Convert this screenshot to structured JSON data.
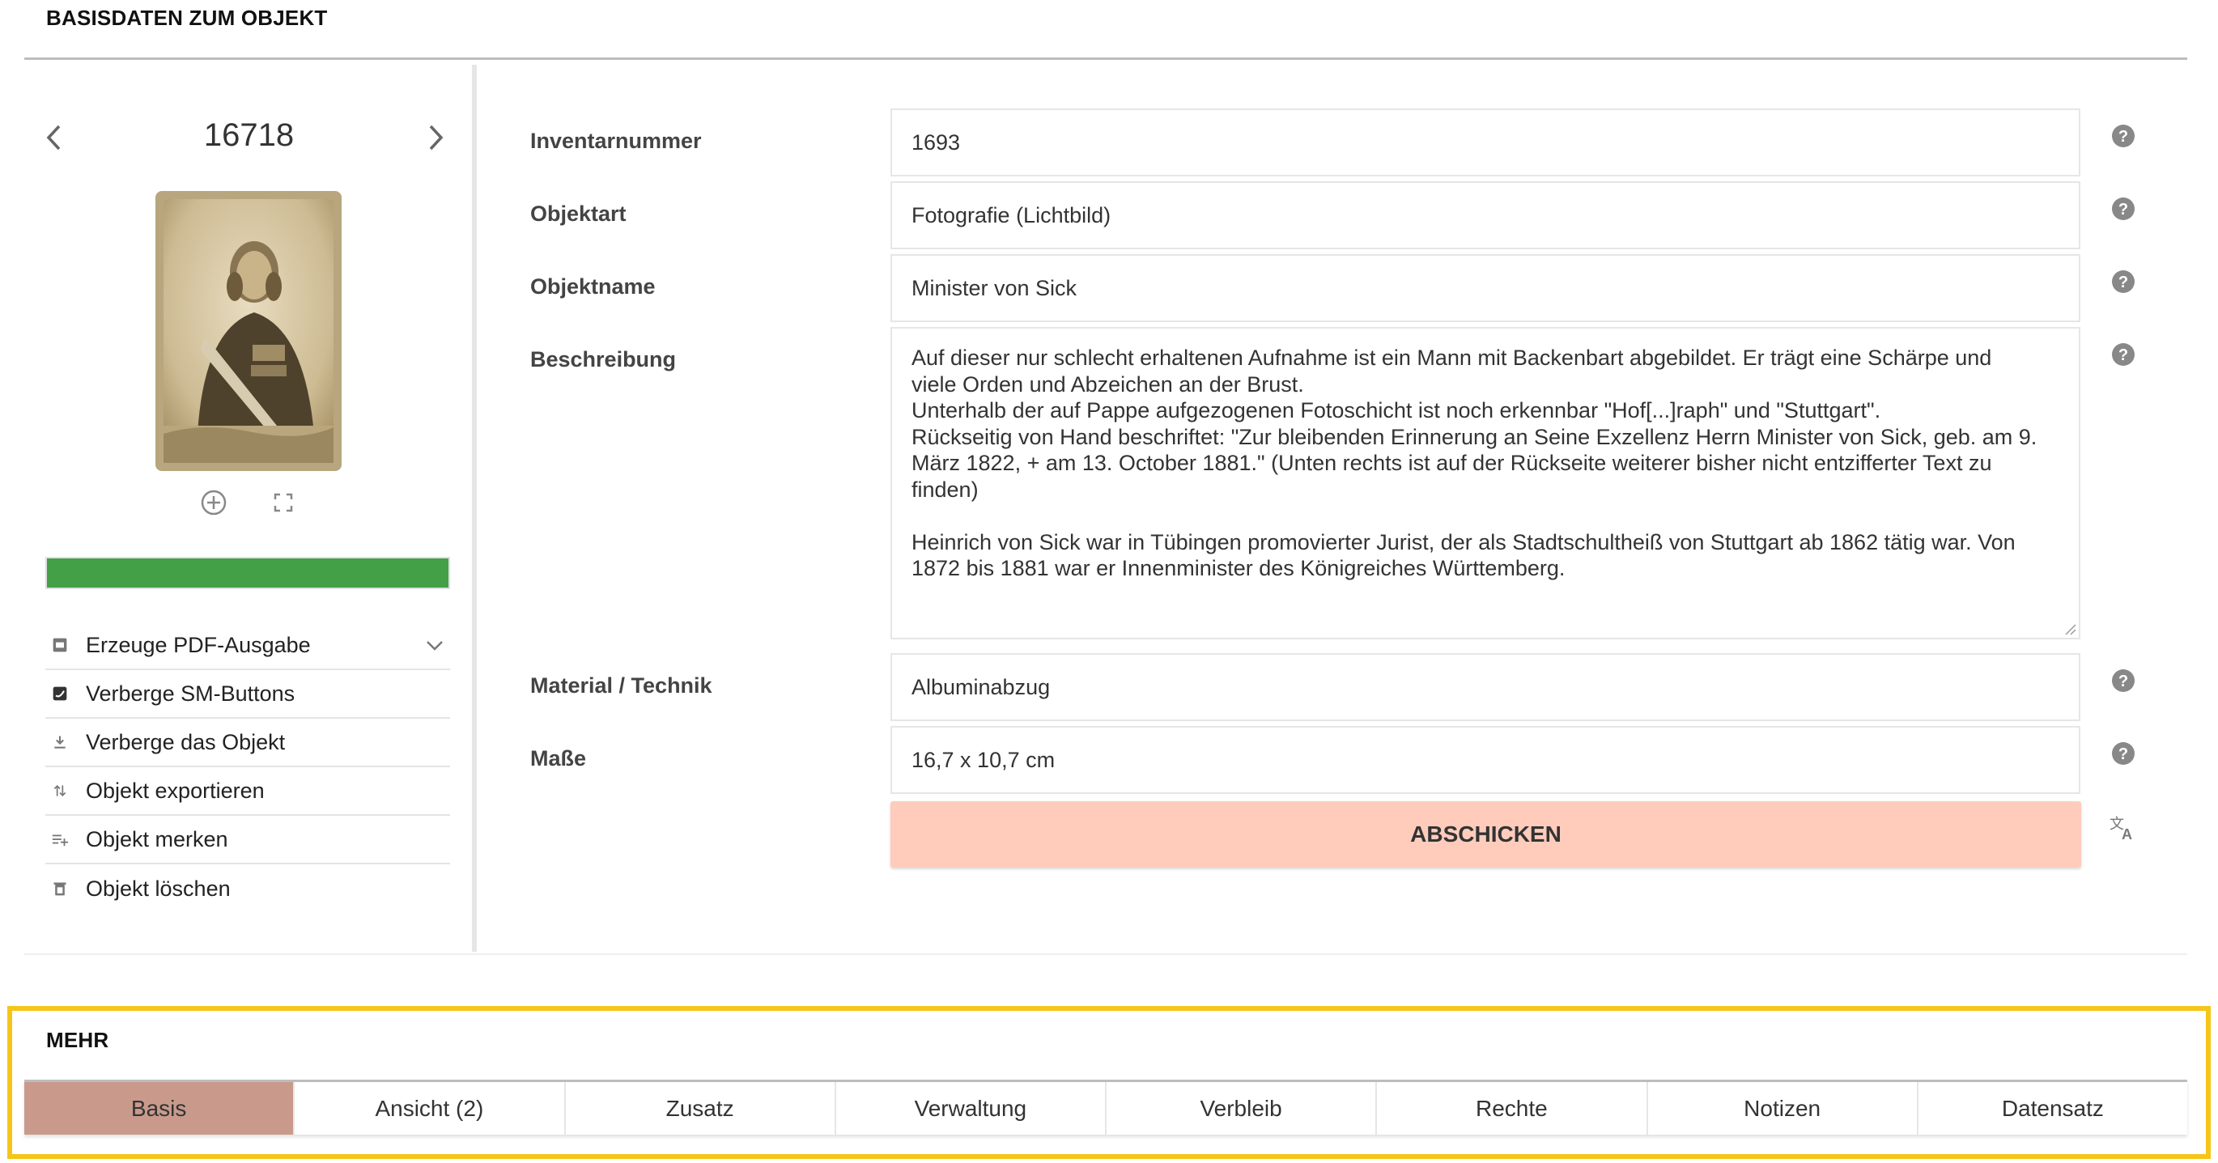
{
  "header": {
    "title": "BASISDATEN ZUM OBJEKT"
  },
  "viewer": {
    "object_number": "16718",
    "progress_fraction": 1.0
  },
  "actions": [
    {
      "label": "Erzeuge PDF-Ausgabe",
      "icon": "pdf-icon"
    },
    {
      "label": "Verberge SM-Buttons",
      "icon": "social-media-icon"
    },
    {
      "label": "Verberge das Objekt",
      "icon": "download-icon"
    },
    {
      "label": "Objekt exportieren",
      "icon": "export-arrows-icon"
    },
    {
      "label": "Objekt merken",
      "icon": "playlist-add-icon"
    },
    {
      "label": "Objekt löschen",
      "icon": "trash-icon"
    }
  ],
  "form": {
    "inventarnummer": {
      "label": "Inventarnummer",
      "value": "1693"
    },
    "objektart": {
      "label": "Objektart",
      "value": "Fotografie (Lichtbild)"
    },
    "objektname": {
      "label": "Objektname",
      "value": "Minister von Sick"
    },
    "beschreibung": {
      "label": "Beschreibung",
      "value": "Auf dieser nur schlecht erhaltenen Aufnahme ist ein Mann mit Backenbart abgebildet. Er trägt eine Schärpe und\nviele Orden und Abzeichen an der Brust.\nUnterhalb der auf Pappe aufgezogenen Fotoschicht ist noch erkennbar \"Hof[...]raph\" und \"Stuttgart\".\nRückseitig von Hand beschriftet: \"Zur bleibenden Erinnerung an Seine Exzellenz Herrn Minister von Sick, geb. am 9.\nMärz 1822, + am 13. October 1881.\" (Unten rechts ist auf der Rückseite weiterer bisher nicht entzifferter Text zu\nfinden)\n\nHeinrich von Sick war in Tübingen promovierter Jurist, der als Stadtschultheiß von Stuttgart ab 1862 tätig war. Von\n1872 bis 1881 war er Innenminister des Königreiches Württemberg."
    },
    "material": {
      "label": "Material / Technik",
      "value": "Albuminabzug"
    },
    "masse": {
      "label": "Maße",
      "value": "16,7 x 10,7 cm"
    },
    "submit_label": "ABSCHICKEN"
  },
  "mehr": {
    "title": "MEHR",
    "tabs": [
      "Basis",
      "Ansicht (2)",
      "Zusatz",
      "Verwaltung",
      "Verbleib",
      "Rechte",
      "Notizen",
      "Datensatz"
    ],
    "active_tab": 0
  },
  "colors": {
    "progress": "#43a047",
    "submit_bg": "#ffccbc",
    "active_tab": "#c99a8c",
    "highlight_frame": "#f5c518"
  }
}
